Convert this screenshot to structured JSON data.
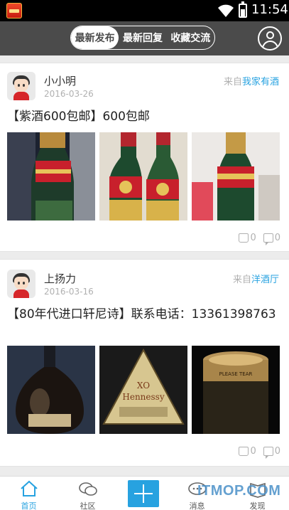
{
  "status_bar": {
    "time": "11:54"
  },
  "header": {
    "tabs": [
      {
        "label": "最新发布",
        "active": true
      },
      {
        "label": "最新回复",
        "active": false
      },
      {
        "label": "收藏交流",
        "active": false
      }
    ]
  },
  "posts": [
    {
      "username": "小小明",
      "date": "2016-03-26",
      "source_prefix": "来自",
      "source_name": "我家有酒",
      "title": "【紫酒600包邮】600包邮",
      "likes": "0",
      "comments": "0"
    },
    {
      "username": "上扬力",
      "date": "2016-03-16",
      "source_prefix": "来自",
      "source_name": "洋酒厅",
      "title": "【80年代进口轩尼诗】联系电话：13361398763",
      "likes": "0",
      "comments": "0"
    }
  ],
  "bottom_nav": {
    "items": [
      {
        "label": "首页",
        "active": true
      },
      {
        "label": "社区",
        "active": false
      },
      {
        "label": "消息",
        "active": false
      },
      {
        "label": "发现",
        "active": false
      }
    ]
  },
  "watermark": "ITMOP.COM",
  "colors": {
    "accent": "#27a2e0",
    "header_bg": "#4b4b4b"
  }
}
